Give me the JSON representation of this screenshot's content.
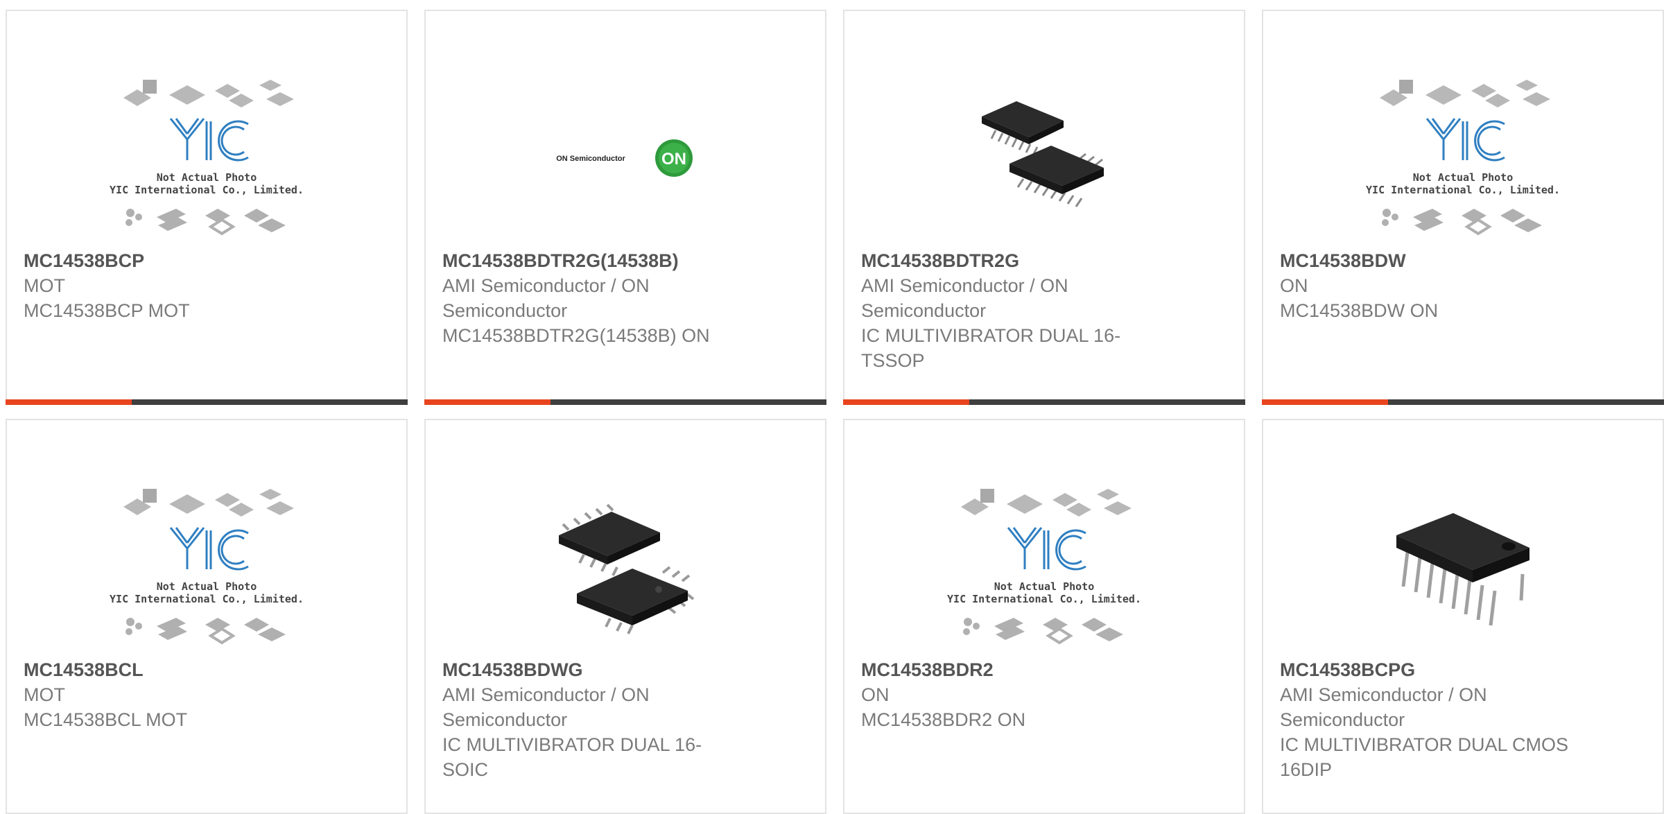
{
  "products": [
    {
      "part_number": "MC14538BCP",
      "manufacturer": "MOT",
      "description": "MC14538BCP MOT",
      "image": "yic-placeholder",
      "placeholder_line1": "Not Actual Photo",
      "placeholder_line2": "YIC International Co., Limited.",
      "accent_color": "#e8451f"
    },
    {
      "part_number": "MC14538BDTR2G(14538B)",
      "manufacturer": "AMI Semiconductor / ON Semiconductor",
      "description": "MC14538BDTR2G(14538B) ON",
      "image": "on-semiconductor-logo",
      "logo_text": "ON Semiconductor",
      "logo_badge": "ON",
      "accent_color": "#e8451f"
    },
    {
      "part_number": "MC14538BDTR2G",
      "manufacturer": "AMI Semiconductor / ON Semiconductor",
      "description": "IC MULTIVIBRATOR DUAL 16-TSSOP",
      "image": "tssop-chip-photo",
      "accent_color": "#e8451f"
    },
    {
      "part_number": "MC14538BDW",
      "manufacturer": "ON",
      "description": "MC14538BDW ON",
      "image": "yic-placeholder",
      "placeholder_line1": "Not Actual Photo",
      "placeholder_line2": "YIC International Co., Limited.",
      "accent_color": "#e8451f"
    },
    {
      "part_number": "MC14538BCL",
      "manufacturer": "MOT",
      "description": "MC14538BCL MOT",
      "image": "yic-placeholder",
      "placeholder_line1": "Not Actual Photo",
      "placeholder_line2": "YIC International Co., Limited."
    },
    {
      "part_number": "MC14538BDWG",
      "manufacturer": "AMI Semiconductor / ON Semiconductor",
      "description": "IC MULTIVIBRATOR DUAL 16-SOIC",
      "image": "soic-chip-photo"
    },
    {
      "part_number": "MC14538BDR2",
      "manufacturer": "ON",
      "description": "MC14538BDR2 ON",
      "image": "yic-placeholder",
      "placeholder_line1": "Not Actual Photo",
      "placeholder_line2": "YIC International Co., Limited."
    },
    {
      "part_number": "MC14538BCPG",
      "manufacturer": "AMI Semiconductor / ON Semiconductor",
      "description": "IC MULTIVIBRATOR DUAL CMOS 16DIP",
      "image": "dip-chip-photo"
    }
  ],
  "colors": {
    "accent": "#e8451f",
    "bar": "#3f3f3f",
    "border": "#e3e3e3",
    "part_number": "#555555",
    "text": "#7a7a7a",
    "yic_blue": "#2f7fc1",
    "on_green": "#2e9a3b"
  }
}
